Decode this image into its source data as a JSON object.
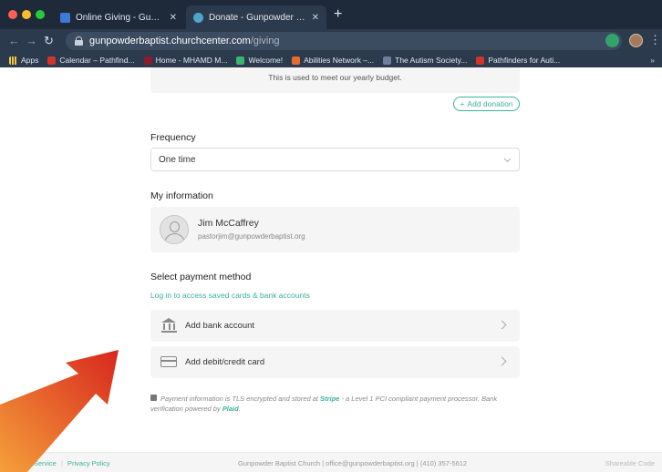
{
  "browser": {
    "tabs": [
      {
        "title": "Online Giving - Gunpowder Bapt",
        "active": false
      },
      {
        "title": "Donate - Gunpowder Baptist Chu",
        "active": true
      }
    ],
    "new_tab": "+",
    "url_host": "gunpowderbaptist.churchcenter.com",
    "url_path": "/giving",
    "bookmarks": [
      {
        "label": "Apps",
        "icon": "apps-grid-icon"
      },
      {
        "label": "Calendar – Pathfind...",
        "icon": "calendar-icon"
      },
      {
        "label": "Home - MHAMD M...",
        "icon": "mhamd-icon"
      },
      {
        "label": "Welcome!",
        "icon": "welcome-icon"
      },
      {
        "label": "Abilities Network –...",
        "icon": "abilities-icon"
      },
      {
        "label": "The Autism Society...",
        "icon": "autism-icon"
      },
      {
        "label": "Pathfinders for Auti...",
        "icon": "pathfinders-icon"
      }
    ],
    "bookmarks_more": "»"
  },
  "giving": {
    "budget_note": "This is used to meet our yearly budget.",
    "add_donation_label": "Add donation",
    "add_donation_plus": "+",
    "frequency_title": "Frequency",
    "frequency_value": "One time",
    "info_title": "My information",
    "user_name": "Jim McCaffrey",
    "user_email": "pastorjim@gunpowderbaptist.org",
    "payment_title": "Select payment method",
    "login_link": "Log in to access saved cards & bank accounts",
    "bank_label": "Add bank account",
    "card_label": "Add debit/credit card",
    "secure_text_1": "Payment information is TLS encrypted and stored at ",
    "secure_stripe": "Stripe",
    "secure_text_2": " - a Level 1 PCI compliant payment processor. Bank verification powered by ",
    "secure_plaid": "Plaid",
    "secure_text_3": "."
  },
  "footer": {
    "terms": "Terms of Service",
    "sep": "|",
    "privacy": "Privacy Policy",
    "center": "Gunpowder Baptist Church  |  office@gunpowderbaptist.org  |  (410) 357-5612",
    "right": "Shareable Code"
  },
  "colors": {
    "accent": "#3cb39a",
    "arrow_start": "#f5a03a",
    "arrow_end": "#d7261e"
  }
}
